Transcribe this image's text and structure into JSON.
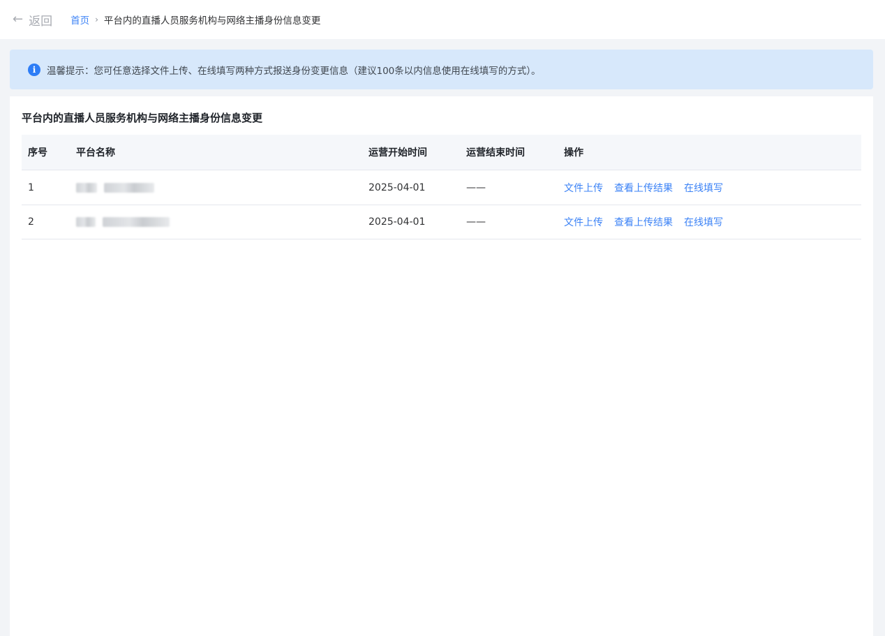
{
  "topbar": {
    "back_label": "返回",
    "breadcrumb": {
      "home": "首页",
      "separator": "›",
      "current": "平台内的直播人员服务机构与网络主播身份信息变更"
    }
  },
  "notice": {
    "icon": "info-icon",
    "text": "温馨提示：您可任意选择文件上传、在线填写两种方式报送身份变更信息（建议100条以内信息使用在线填写的方式）。"
  },
  "panel": {
    "title": "平台内的直播人员服务机构与网络主播身份信息变更",
    "columns": [
      "序号",
      "平台名称",
      "运营开始时间",
      "运营结束时间",
      "操作"
    ],
    "rows": [
      {
        "index": "1",
        "name": "",
        "start": "2025-04-01",
        "end": "——",
        "actions": [
          "文件上传",
          "查看上传结果",
          "在线填写"
        ]
      },
      {
        "index": "2",
        "name": "",
        "start": "2025-04-01",
        "end": "——",
        "actions": [
          "文件上传",
          "查看上传结果",
          "在线填写"
        ]
      }
    ]
  },
  "colors": {
    "link": "#3b82f6",
    "notice_bg": "#d7e8fb",
    "info_icon": "#2d7df6",
    "page_bg": "#f2f4f7"
  }
}
